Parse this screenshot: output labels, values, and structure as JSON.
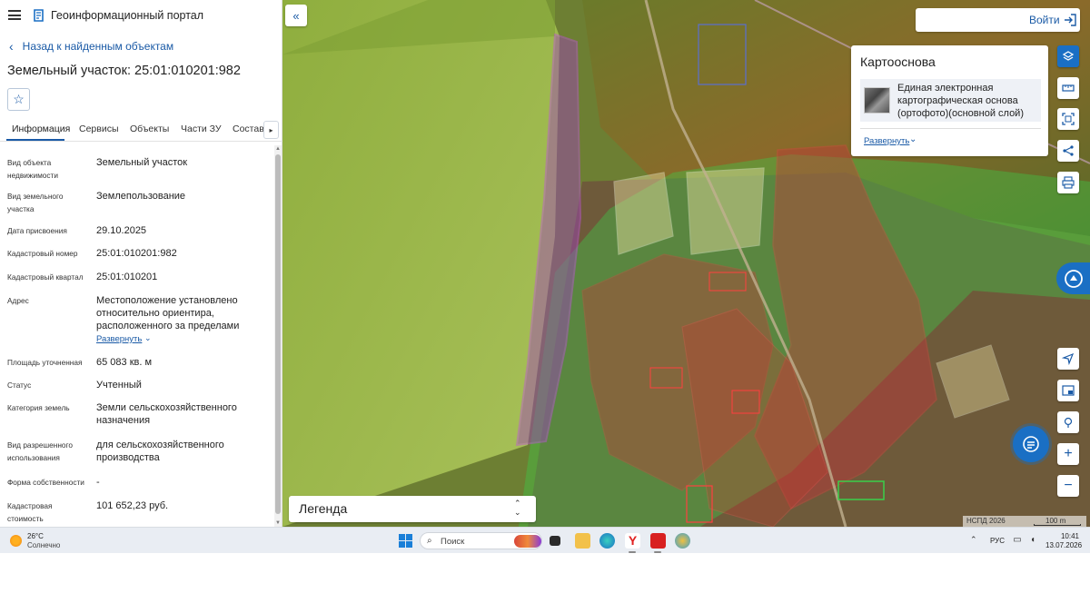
{
  "app": {
    "title": "Геоинформационный портал",
    "back_label": "Назад к найденным объектам",
    "object_title": "Земельный участок: 25:01:010201:982"
  },
  "tabs": [
    {
      "label": "Информация",
      "active": true
    },
    {
      "label": "Сервисы",
      "active": false
    },
    {
      "label": "Объекты",
      "active": false
    },
    {
      "label": "Части ЗУ",
      "active": false
    },
    {
      "label": "Состав",
      "active": false
    }
  ],
  "info": {
    "object_type": {
      "label": "Вид объекта недвижимости",
      "value": "Земельный участок"
    },
    "parcel_type": {
      "label": "Вид земельного участка",
      "value": "Землепользование"
    },
    "assign_date": {
      "label": "Дата присвоения",
      "value": "29.10.2025"
    },
    "cad_number": {
      "label": "Кадастровый номер",
      "value": "25:01:010201:982"
    },
    "cad_quarter": {
      "label": "Кадастровый квартал",
      "value": "25:01:010201"
    },
    "address": {
      "label": "Адрес",
      "value": "Местоположение установлено относительно ориентира, расположенного за пределами",
      "expand": "Развернуть"
    },
    "area": {
      "label": "Площадь уточненная",
      "value": "65 083 кв. м"
    },
    "status": {
      "label": "Статус",
      "value": "Учтенный"
    },
    "land_category": {
      "label": "Категория земель",
      "value": "Земли сельскохозяйственного назначения"
    },
    "permitted_use": {
      "label": "Вид разрешенного использования",
      "value": "для сельскохозяйственного производства"
    },
    "ownership": {
      "label": "Форма собственности",
      "value": "-"
    },
    "cad_value": {
      "label": "Кадастровая стоимость",
      "value": "101 652,23 руб."
    }
  },
  "map": {
    "login_label": "Войти",
    "basemap_title": "Картооснова",
    "basemap_item": "Единая электронная картографическая основа (ортофото)(основной слой)",
    "basemap_expand": "Развернуть",
    "legend_label": "Легенда",
    "attribution": "НСПД 2026",
    "scale_label": "100 m"
  },
  "taskbar": {
    "weather_temp": "26°C",
    "weather_desc": "Солнечно",
    "search_placeholder": "Поиск",
    "lang": "РУС",
    "time": "10:41",
    "date": "13.07.2026"
  },
  "colors": {
    "accent": "#1a6fc4",
    "link": "#1a5aa6",
    "selected_parcel": "#a040c0",
    "zone_green": "#3ad04a",
    "zone_red": "#d0303a"
  }
}
